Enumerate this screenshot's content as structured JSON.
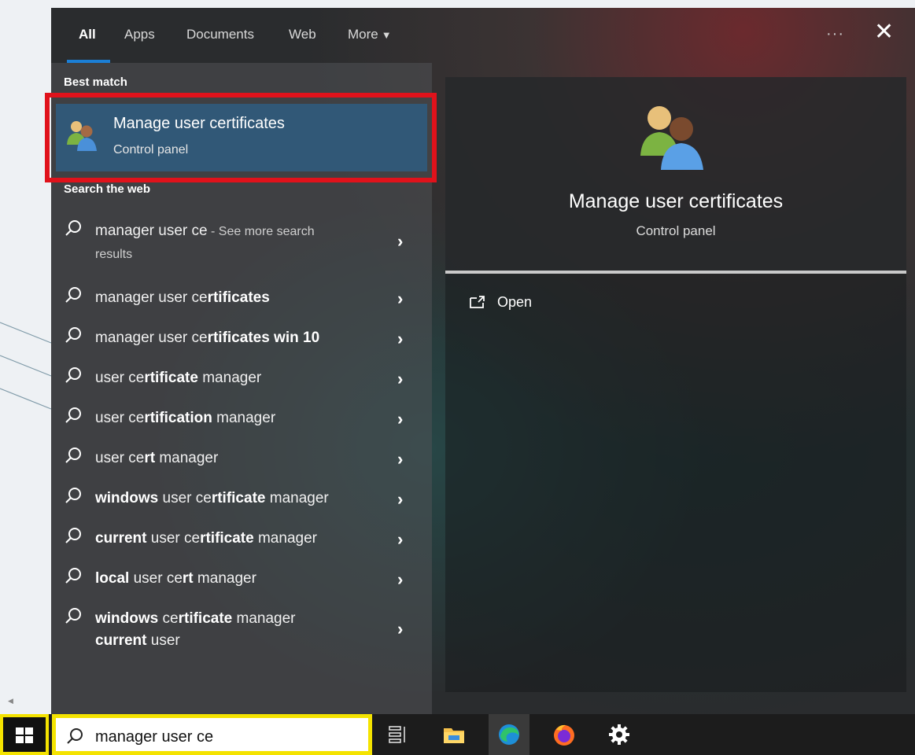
{
  "tabs": [
    {
      "label": "All"
    },
    {
      "label": "Apps"
    },
    {
      "label": "Documents"
    },
    {
      "label": "Web"
    },
    {
      "label": "More"
    }
  ],
  "header": {
    "more_icon": "ellipsis-icon",
    "close_icon": "close-icon",
    "dots": "···",
    "close_glyph": "✕"
  },
  "best_match": {
    "section_label": "Best match",
    "title": "Manage user certificates",
    "subtitle": "Control panel",
    "icon": "users-icon"
  },
  "web": {
    "section_label": "Search the web",
    "results": [
      {
        "parts": [
          {
            "t": "manager user ce",
            "b": false
          }
        ],
        "sub_a": " - See more search",
        "sub_b": "results"
      },
      {
        "parts": [
          {
            "t": "manager user ce",
            "b": false
          },
          {
            "t": "rtificates",
            "b": true
          }
        ]
      },
      {
        "parts": [
          {
            "t": "manager user ce",
            "b": false
          },
          {
            "t": "rtificates win 10",
            "b": true
          }
        ]
      },
      {
        "parts": [
          {
            "t": "user ce",
            "b": false
          },
          {
            "t": "rtificate",
            "b": true
          },
          {
            "t": " manager",
            "b": false
          }
        ]
      },
      {
        "parts": [
          {
            "t": "user ce",
            "b": false
          },
          {
            "t": "rtification",
            "b": true
          },
          {
            "t": " manager",
            "b": false
          }
        ]
      },
      {
        "parts": [
          {
            "t": "user ce",
            "b": false
          },
          {
            "t": "rt",
            "b": true
          },
          {
            "t": " manager",
            "b": false
          }
        ]
      },
      {
        "parts": [
          {
            "t": "windows",
            "b": true
          },
          {
            "t": " user ce",
            "b": false
          },
          {
            "t": "rtificate",
            "b": true
          },
          {
            "t": " manager",
            "b": false
          }
        ]
      },
      {
        "parts": [
          {
            "t": "current",
            "b": true
          },
          {
            "t": " user ce",
            "b": false
          },
          {
            "t": "rtificate",
            "b": true
          },
          {
            "t": " manager",
            "b": false
          }
        ]
      },
      {
        "parts": [
          {
            "t": "local",
            "b": true
          },
          {
            "t": " user ce",
            "b": false
          },
          {
            "t": "rt",
            "b": true
          },
          {
            "t": " manager",
            "b": false
          }
        ]
      },
      {
        "parts": [
          {
            "t": "windows",
            "b": true
          },
          {
            "t": " ce",
            "b": false
          },
          {
            "t": "rtificate",
            "b": true
          },
          {
            "t": " manager",
            "b": false
          },
          {
            "t": "\n",
            "b": false
          },
          {
            "t": "current",
            "b": true
          },
          {
            "t": " user",
            "b": false
          }
        ]
      }
    ]
  },
  "preview": {
    "title": "Manage user certificates",
    "subtitle": "Control panel",
    "open_label": "Open"
  },
  "taskbar": {
    "search_value": "manager user ce",
    "icons": [
      "windows-start-icon",
      "task-view-icon",
      "file-explorer-icon",
      "edge-icon",
      "firefox-icon",
      "settings-gear-icon"
    ]
  },
  "colors": {
    "accent": "#1b7fd6",
    "highlight": "#315877",
    "outline_red": "#e0121b",
    "outline_yellow": "#f4e300"
  }
}
